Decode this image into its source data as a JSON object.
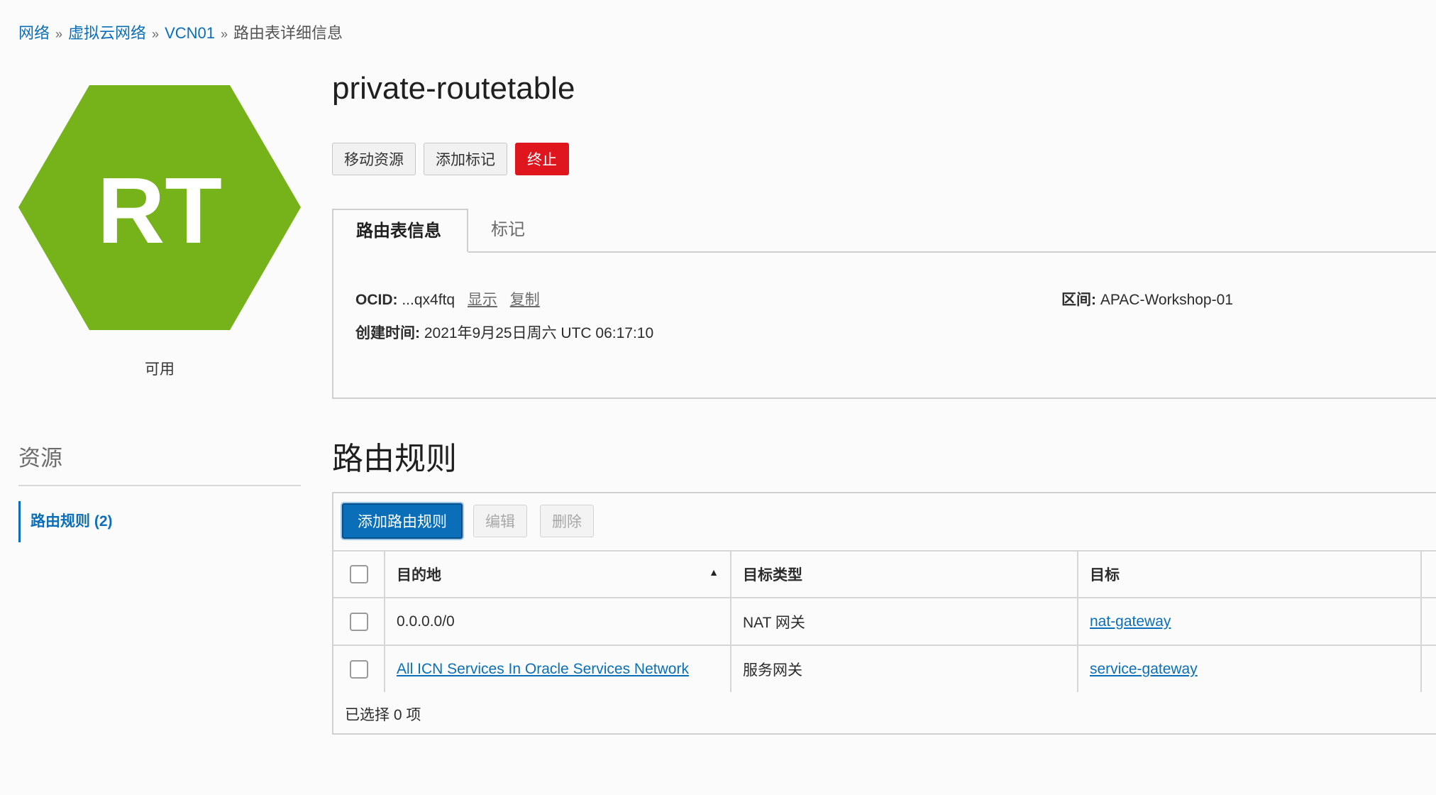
{
  "breadcrumb": {
    "items": [
      "网络",
      "虚拟云网络",
      "VCN01"
    ],
    "current": "路由表详细信息",
    "separator": "»"
  },
  "resource_icon": {
    "text": "RT",
    "color": "#76b31a"
  },
  "status": "可用",
  "resources": {
    "title": "资源",
    "items": [
      {
        "label": "路由规则 (2)"
      }
    ]
  },
  "page_title": "private-routetable",
  "actions": {
    "move": "移动资源",
    "add_tag": "添加标记",
    "terminate": "终止"
  },
  "tabs": [
    {
      "label": "路由表信息",
      "active": true
    },
    {
      "label": "标记",
      "active": false
    }
  ],
  "info": {
    "ocid_label": "OCID:",
    "ocid_value": "...qx4ftq",
    "show_link": "显示",
    "copy_link": "复制",
    "compartment_label": "区间:",
    "compartment_value": "APAC-Workshop-01",
    "created_label": "创建时间:",
    "created_value": "2021年9月25日周六 UTC 06:17:10"
  },
  "rules": {
    "title": "路由规则",
    "add_button": "添加路由规则",
    "edit_button": "编辑",
    "delete_button": "删除",
    "columns": [
      "目的地",
      "目标类型",
      "目标"
    ],
    "rows": [
      {
        "destination": "0.0.0.0/0",
        "destination_is_link": false,
        "target_type": "NAT 网关",
        "target": "nat-gateway"
      },
      {
        "destination": "All ICN Services In Oracle Services Network",
        "destination_is_link": true,
        "target_type": "服务网关",
        "target": "service-gateway"
      }
    ],
    "selected_status": "已选择 0 项"
  },
  "colors": {
    "link": "#0a6fb8",
    "danger": "#e0161e",
    "primary": "#0a6fb8",
    "hexagon": "#76b31a"
  }
}
